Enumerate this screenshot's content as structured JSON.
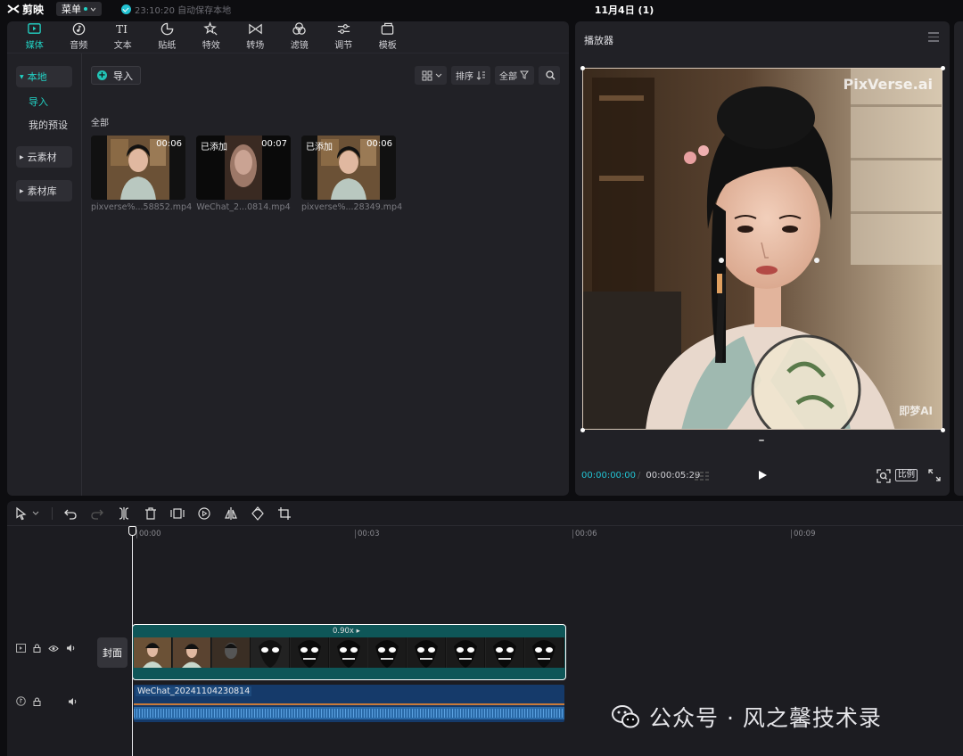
{
  "app": {
    "name": "剪映",
    "menu_label": "菜单",
    "save_status": "23:10:20 自动保存本地",
    "project_title": "11月4日 (1)"
  },
  "toolbar": {
    "tabs": [
      {
        "label": "媒体",
        "icon": "media-icon"
      },
      {
        "label": "音频",
        "icon": "audio-icon"
      },
      {
        "label": "文本",
        "icon": "text-icon"
      },
      {
        "label": "贴纸",
        "icon": "sticker-icon"
      },
      {
        "label": "特效",
        "icon": "effects-icon"
      },
      {
        "label": "转场",
        "icon": "transition-icon"
      },
      {
        "label": "滤镜",
        "icon": "filter-icon"
      },
      {
        "label": "调节",
        "icon": "adjust-icon"
      },
      {
        "label": "模板",
        "icon": "template-icon"
      }
    ],
    "active_index": 0
  },
  "left_nav": {
    "local": "本地",
    "import": "导入",
    "my_presets": "我的预设",
    "cloud": "云素材",
    "library": "素材库"
  },
  "media": {
    "import_button": "导入",
    "all_label": "全部",
    "sort_label": "排序",
    "filter_label": "全部",
    "items": [
      {
        "name": "pixverse%...58852.mp4",
        "duration": "00:06",
        "added": ""
      },
      {
        "name": "WeChat_2...0814.mp4",
        "duration": "00:07",
        "added": "已添加"
      },
      {
        "name": "pixverse%...28349.mp4",
        "duration": "00:06",
        "added": "已添加"
      }
    ]
  },
  "player": {
    "title": "播放器",
    "watermark_top": "PixVerse.ai",
    "watermark_bottom": "即梦AI",
    "current_time": "00:00:00:00",
    "total_time": "00:00:05:29",
    "ratio_label": "比例"
  },
  "timeline": {
    "ruler": [
      "00:00",
      "00:03",
      "00:06",
      "00:09"
    ],
    "cover_label": "封面",
    "video_clip_speed": "0.90x ▸",
    "audio_clip_name": "WeChat_20241104230814"
  },
  "watermark": {
    "text": "公众号 · 风之馨技术录"
  },
  "colors": {
    "accent": "#22d3c5",
    "panel": "#212126",
    "background": "#0d0d10",
    "video_clip": "#0e5658",
    "audio_clip": "#153a6a"
  }
}
